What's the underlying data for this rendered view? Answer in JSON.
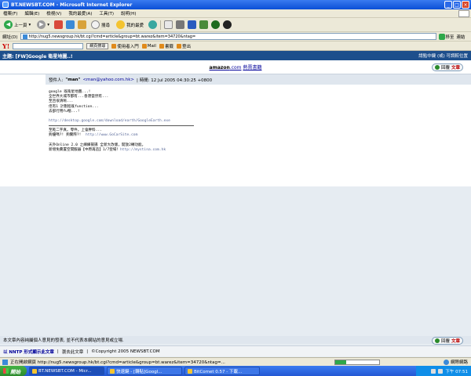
{
  "window": {
    "title": "BT.NEWSBT.COM - Microsoft Internet Explorer"
  },
  "menu": [
    "檔案(F)",
    "編輯(E)",
    "檢視(V)",
    "我的最愛(A)",
    "工具(T)",
    "說明(H)"
  ],
  "toolbar": {
    "back": "上一頁",
    "search": "搜尋",
    "favorites": "我的最愛"
  },
  "address": {
    "label": "網址(D)",
    "url": "http://nug5.newsgroup.hk/bt.cgi?cmd=article&group=bt.warez&item=34720&ntag=",
    "go": "移至",
    "links": "連結"
  },
  "yahoo": {
    "logo": "Y!",
    "search_button": "網頁搜尋",
    "user_entry": "使用者入門",
    "mail": "Mail",
    "bookmarks": "書籤",
    "logout": "登出"
  },
  "topic": {
    "title": "主題: [FW]Google 衛星地圖..!",
    "right_text": "請點中鍵 (或) 可調較位置"
  },
  "ad": {
    "brand": "amazon",
    "domain": ".com",
    "link": "熱賣書籍"
  },
  "reply": {
    "label": "回覆",
    "label2": "文章"
  },
  "post": {
    "header_prefix": "發件人:",
    "author": "\"man\"",
    "email": "<man@yahoo.com.hk>",
    "time": "| 時間: 12 Jul 2005 04:30:25 +0800",
    "lines": [
      "google 既衛星地圖...!",
      "全世界大城市都有...香港當然有...",
      "至且很清晰...",
      "佢有1 計劃程既function...",
      "去部行用fu嗰...!"
    ],
    "link1": "http://desktop.google.com/download/earth/GoogleEarth.exe",
    "sig": [
      "至乾二字真。零件。上會胖料...",
      "夠優嗎?! 夠實際?!"
    ],
    "sig_link": "http://www.GoCarSite.com",
    "sig2": [
      "天外Online 2.0 之練練揚揚 全新大改版，開放2轉功能。",
      "新增免費置空間服器【中原再造】1/7登場！"
    ],
    "sig2_link": "http://mystina.com.hk"
  },
  "disclaimer": "本文章內容純屬個人意見的發表, 並不代表本網站的意見或立場.",
  "footer": {
    "nntp": "以 NNTP 形式顯示此文章",
    "next": "瀏去此文章",
    "copyright": "Copyright 2005 NEWSBT.COM"
  },
  "status": {
    "text": "正在開啟網頁 http://nug5.newsgroup.hk/bt.cgi?cmd=article&group=bt.warez&item=34720&ntag=...",
    "zone": "網際網路",
    "progress": 0.25
  },
  "taskbar": {
    "start": "開始",
    "tasks": [
      "BT.NEWSBT.COM - Micr...",
      "快速鍵 - [轉貼]Googl...",
      "BitComet 0.57 - 下載..."
    ],
    "clock": "下午 07:51"
  }
}
